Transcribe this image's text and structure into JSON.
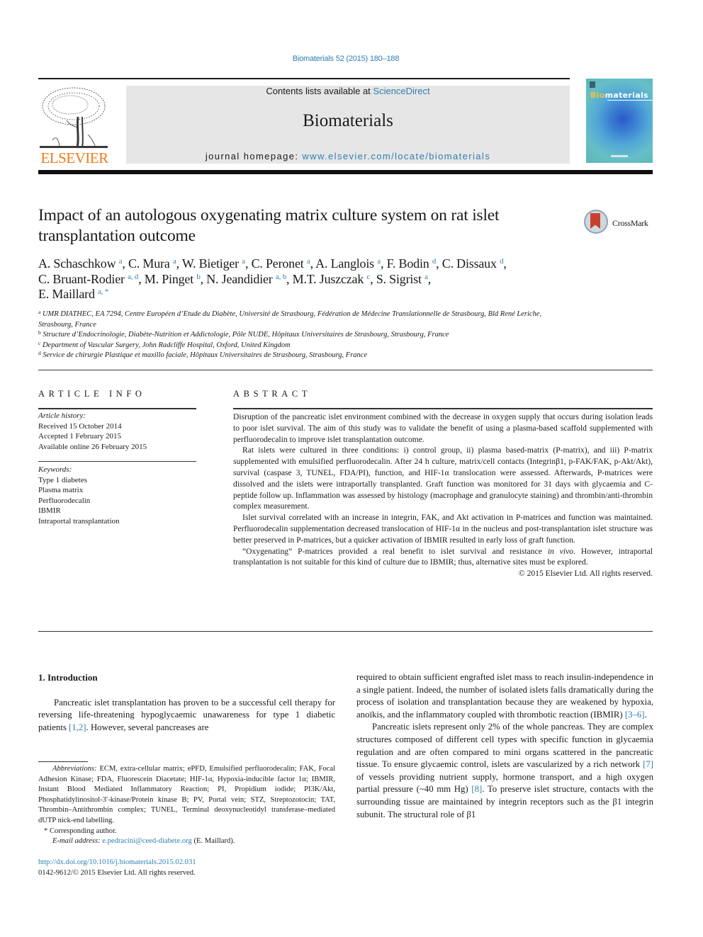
{
  "journal_ref": "Biomaterials 52 (2015) 180–188",
  "masthead": {
    "publisher_logo_text": "ELSEVIER",
    "contents_prefix": "Contents lists available at ",
    "contents_link": "ScienceDirect",
    "journal_name": "Biomaterials",
    "homepage_prefix": "journal homepage: ",
    "homepage_link": "www.elsevier.com/locate/biomaterials",
    "cover_title_highlight": "Bio",
    "cover_title_rest": "materials"
  },
  "title": "Impact of an autologous oxygenating matrix culture system on rat islet transplantation outcome",
  "crossmark_label": "CrossMark",
  "authors": [
    {
      "name": "A. Schaschkow",
      "aff": "a"
    },
    {
      "name": "C. Mura",
      "aff": "a"
    },
    {
      "name": "W. Bietiger",
      "aff": "a"
    },
    {
      "name": "C. Peronet",
      "aff": "a"
    },
    {
      "name": "A. Langlois",
      "aff": "a"
    },
    {
      "name": "F. Bodin",
      "aff": "d"
    },
    {
      "name": "C. Dissaux",
      "aff": "d"
    },
    {
      "name": "C. Bruant-Rodier",
      "aff": "a, d"
    },
    {
      "name": "M. Pinget",
      "aff": "b"
    },
    {
      "name": "N. Jeandidier",
      "aff": "a, b"
    },
    {
      "name": "M.T. Juszczak",
      "aff": "c"
    },
    {
      "name": "S. Sigrist",
      "aff": "a"
    },
    {
      "name": "E. Maillard",
      "aff": "a, *"
    }
  ],
  "affiliations": [
    {
      "key": "a",
      "text": "UMR DIATHEC, EA 7294, Centre Européen d’Etude du Diabète, Université de Strasbourg, Fédération de Médecine Translationnelle de Strasbourg, Bld René Leriche, Strasbourg, France"
    },
    {
      "key": "b",
      "text": "Structure d’Endocrinologie, Diabète-Nutrition et Addictologie, Pôle NUDE, Hôpitaux Universitaires de Strasbourg, Strasbourg, France"
    },
    {
      "key": "c",
      "text": "Department of Vascular Surgery, John Radcliffe Hospital, Oxford, United Kingdom"
    },
    {
      "key": "d",
      "text": "Service de chirurgie Plastique et maxillo faciale, Hôpitaux Universitaires de Strasbourg, Strasbourg, France"
    }
  ],
  "article_info": {
    "heading": "ARTICLE INFO",
    "history_label": "Article history:",
    "history": [
      "Received 15 October 2014",
      "Accepted 1 February 2015",
      "Available online 26 February 2015"
    ],
    "keywords_label": "Keywords:",
    "keywords": [
      "Type 1 diabetes",
      "Plasma matrix",
      "Perfluorodecalin",
      "IBMIR",
      "Intraportal transplantation"
    ]
  },
  "abstract": {
    "heading": "ABSTRACT",
    "paragraphs": [
      "Disruption of the pancreatic islet environment combined with the decrease in oxygen supply that occurs during isolation leads to poor islet survival. The aim of this study was to validate the benefit of using a plasma-based scaffold supplemented with perfluorodecalin to improve islet transplantation outcome.",
      "Rat islets were cultured in three conditions: i) control group, ii) plasma based-matrix (P-matrix), and iii) P-matrix supplemented with emulsified perfluorodecalin. After 24 h culture, matrix/cell contacts (Integrinβ1, p-FAK/FAK, p-Akt/Akt), survival (caspase 3, TUNEL, FDA/PI), function, and HIF-1α translocation were assessed. Afterwards, P-matrices were dissolved and the islets were intraportally transplanted. Graft function was monitored for 31 days with glycaemia and C-peptide follow up. Inflammation was assessed by histology (macrophage and granulocyte staining) and thrombin/anti-thrombin complex measurement.",
      "Islet survival correlated with an increase in integrin, FAK, and Akt activation in P-matrices and function was maintained. Perfluorodecalin supplementation decreased translocation of HIF-1α in the nucleus and post-transplantation islet structure was better preserved in P-matrices, but a quicker activation of IBMIR resulted in early loss of graft function."
    ],
    "last_para_before": "“Oxygenating” P-matrices provided a real benefit to islet survival and resistance ",
    "last_para_italic": "in vivo",
    "last_para_after": ". However, intraportal transplantation is not suitable for this kind of culture due to IBMIR; thus, alternative sites must be explored.",
    "copyright": "© 2015 Elsevier Ltd. All rights reserved."
  },
  "introduction": {
    "heading": "1.  Introduction",
    "p1_before": "Pancreatic islet transplantation has proven to be a successful cell therapy for reversing life-threatening hypoglycaemic unawareness for type 1 diabetic patients ",
    "p1_ref": "[1,2]",
    "p1_after": ". However, several pancreases are",
    "p1_cont_before": "required to obtain sufficient engrafted islet mass to reach insulin-independence in a single patient. Indeed, the number of isolated islets falls dramatically during the process of isolation and transplantation because they are weakened by hypoxia, anoïkis, and the inflammatory coupled with thrombotic reaction (IBMIR) ",
    "p1_cont_ref": "[3–6]",
    "p1_cont_after": ".",
    "p2_a": "Pancreatic islets represent only 2% of the whole pancreas. They are complex structures composed of different cell types with specific function in glycaemia regulation and are often compared to mini organs scattered in the pancreatic tissue. To ensure glycaemic control, islets are vascularized by a rich network ",
    "p2_ref1": "[7]",
    "p2_b": " of vessels providing nutrient supply, hormone transport, and a high oxygen partial pressure (~40 mm Hg) ",
    "p2_ref2": "[8]",
    "p2_c": ". To preserve islet structure, contacts with the surrounding tissue are maintained by integrin receptors such as the β1 integrin subunit. The structural role of β1"
  },
  "footnotes": {
    "abbrev_label": "Abbreviations:",
    "abbrev_text": " ECM, extra-cellular matrix; ePFD, Emulsified perfluorodecalin; FAK, Focal Adhesion Kinase; FDA, Fluorescein Diacetate; HIF-1α, Hypoxia-inducible factor 1α; IBMIR, Instant Blood Mediated Inflammatory Reaction; PI, Propidium iodide; PI3K/Akt, Phosphatidylinositol-3′-kinase/Protein kinase B; PV, Portal vein; STZ, Streptozotocin; TAT, Thrombin–Antithrombin complex; TUNEL, Terminal deoxynucleotidyl transferase–mediated dUTP nick-end labelling.",
    "corresponding": "* Corresponding author.",
    "email_label": "E-mail address:",
    "email": "e.pedracini@ceed-diabete.org",
    "email_suffix": " (E. Maillard).",
    "doi": "http://dx.doi.org/10.1016/j.biomaterials.2015.02.031",
    "issn_line": "0142-9612/© 2015 Elsevier Ltd. All rights reserved."
  }
}
